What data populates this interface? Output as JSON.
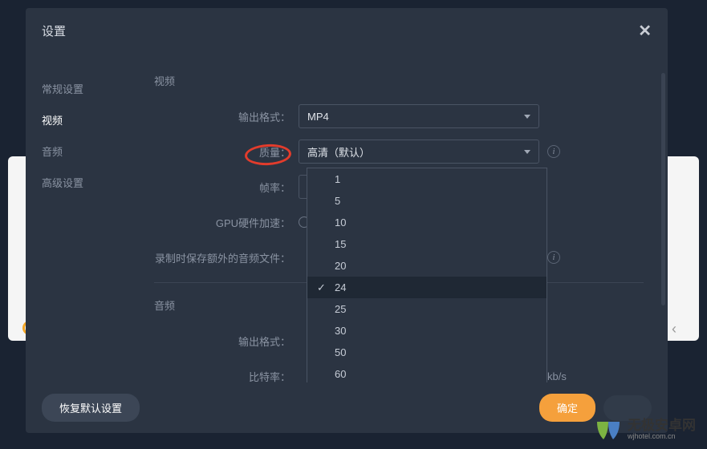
{
  "dialog": {
    "title": "设置"
  },
  "sidebar": {
    "items": [
      {
        "label": "常规设置",
        "active": false
      },
      {
        "label": "视频",
        "active": true
      },
      {
        "label": "音频",
        "active": false
      },
      {
        "label": "高级设置",
        "active": false
      }
    ]
  },
  "video": {
    "section_title": "视频",
    "output_format": {
      "label": "输出格式：",
      "value": "MP4"
    },
    "quality": {
      "label": "质量：",
      "value": "高清（默认）"
    },
    "framerate": {
      "label": "帧率：",
      "value": "24"
    },
    "gpu": {
      "label": "GPU硬件加速："
    },
    "extra_audio": {
      "label": "录制时保存额外的音频文件："
    }
  },
  "audio": {
    "section_title": "音频",
    "output_format": {
      "label": "输出格式："
    },
    "bitrate": {
      "label": "比特率：",
      "unit": "kb/s"
    }
  },
  "dropdown": {
    "options": [
      "1",
      "5",
      "10",
      "15",
      "20",
      "24",
      "25",
      "30",
      "50",
      "60"
    ],
    "selected": "24"
  },
  "footer": {
    "restore": "恢复默认设置",
    "ok": "确定"
  },
  "watermark": {
    "cn": "无极安卓网",
    "en": "wjhotel.com.cn"
  }
}
